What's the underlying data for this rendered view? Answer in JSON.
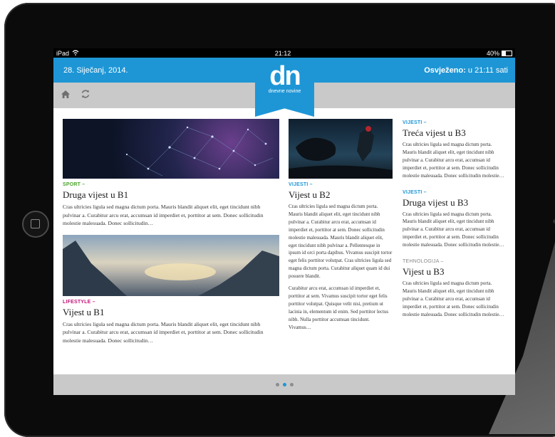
{
  "status_bar": {
    "device": "iPad",
    "time": "21:12",
    "battery": "40%"
  },
  "header": {
    "date": "28. Siječanj, 2014.",
    "refreshed_label": "Osvježeno:",
    "refreshed_value": " u 21:11 sati"
  },
  "logo": {
    "mark": "dn",
    "subtitle": "dnevne novine"
  },
  "toolbar": {
    "home_icon": "home-icon",
    "refresh_icon": "refresh-icon"
  },
  "articles": {
    "a1": {
      "category": "SPORT –",
      "title": "Druga vijest u B1",
      "body": "Cras ultricies ligula sed magna dictum porta. Mauris blandit aliquet elit, eget tincidunt nibh pulvinar a. Curabitur arcu erat, accumsan id imperdiet et, porttitor at sem. Donec sollicitudin molestie malesuada. Donec sollicitudin…"
    },
    "a2": {
      "category": "LIFESTYLE –",
      "title": "Vijest u B1",
      "body": "Cras ultricies ligula sed magna dictum porta. Mauris blandit aliquet elit, eget tincidunt nibh pulvinar a. Curabitur arcu erat, accumsan id imperdiet et, porttitor at sem. Donec sollicitudin molestie malesuada. Donec sollicitudin…"
    },
    "a3": {
      "category": "VIJESTI –",
      "title": "Vijest u B2",
      "body": "Cras ultricies ligula sed magna dictum porta. Mauris blandit aliquet elit, eget tincidunt nibh pulvinar a. Curabitur arcu erat, accumsan id imperdiet et, porttitor at sem. Donec sollicitudin molestie malesuada. Mauris blandit aliquet elit, eget tincidunt nibh pulvinar a. Pellentesque in ipsum id orci porta dapibus. Vivamus suscipit tortor eget felis porttitor volutpat. Cras ultricies ligula sed magna dictum porta. Curabitur aliquet quam id dui posuere blandit.",
      "body2": "Curabitur arcu erat, accumsan id imperdiet et, porttitor at sem. Vivamus suscipit tortor eget felis porttitor volutpat. Quisque velit nisi, pretium ut lacinia in, elementum id enim. Sed porttitor lectus nibh. Nulla porttitor accumsan tincidunt. Vivamus…"
    },
    "a4": {
      "category": "VIJESTI –",
      "title": "Treća vijest u B3",
      "body": "Cras ultricies ligula sed magna dictum porta. Mauris blandit aliquet elit, eget tincidunt nibh pulvinar a. Curabitur arcu erat, accumsan id imperdiet et, porttitor at sem. Donec sollicitudin molestie malesuada. Donec sollicitudin molestie…"
    },
    "a5": {
      "category": "VIJESTI –",
      "title": "Druga vijest u B3",
      "body": "Cras ultricies ligula sed magna dictum porta. Mauris blandit aliquet elit, eget tincidunt nibh pulvinar a. Curabitur arcu erat, accumsan id imperdiet et, porttitor at sem. Donec sollicitudin molestie malesuada. Donec sollicitudin molestie…"
    },
    "a6": {
      "category": "TEHNOLOGIJA –",
      "title": "Vijest u B3",
      "body": "Cras ultricies ligula sed magna dictum porta. Mauris blandit aliquet elit, eget tincidunt nibh pulvinar a. Curabitur arcu erat, accumsan id imperdiet et, porttitor at sem. Donec sollicitudin molestie malesuada. Donec sollicitudin molestie…"
    }
  },
  "pager": {
    "pages": 3,
    "active_index": 1
  },
  "colors": {
    "accent": "#1e96d6",
    "sport": "#4aa52b",
    "lifestyle": "#c2187a",
    "toolbar_bg": "#c9c9c9"
  }
}
